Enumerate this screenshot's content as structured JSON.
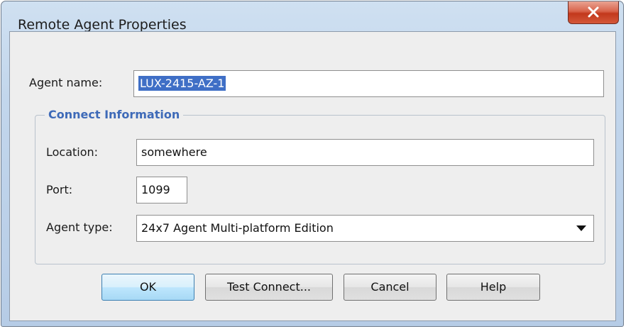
{
  "window": {
    "title": "Remote Agent Properties"
  },
  "fields": {
    "agent_name_label": "Agent name:",
    "agent_name_value": "LUX-2415-AZ-1"
  },
  "connect": {
    "group_title": "Connect Information",
    "location_label": "Location:",
    "location_value": "somewhere",
    "port_label": "Port:",
    "port_value": "1099",
    "agent_type_label": "Agent type:",
    "agent_type_value": "24x7 Agent Multi-platform Edition"
  },
  "buttons": {
    "ok": "OK",
    "test_connect": "Test Connect...",
    "cancel": "Cancel",
    "help": "Help"
  },
  "icons": {
    "close": "close-icon",
    "dropdown": "chevron-down-icon"
  },
  "colors": {
    "group_title": "#3e6ab8",
    "selection": "#3f6fc6",
    "close_button": "#c2381c"
  }
}
